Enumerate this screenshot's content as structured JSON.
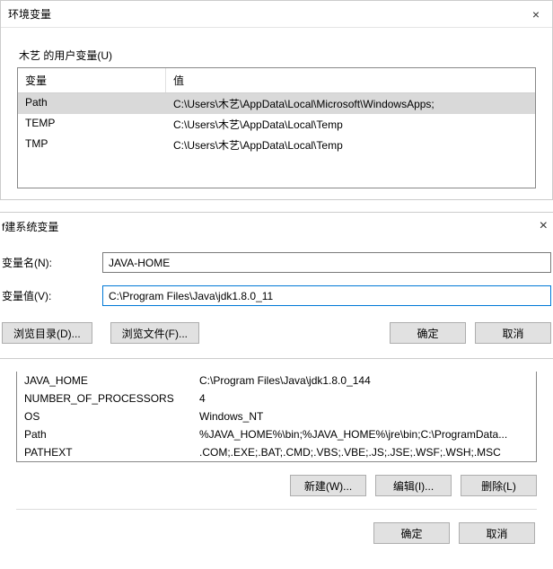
{
  "main_dialog": {
    "title": "环境变量",
    "user_section_label": "木艺 的用户变量(U)",
    "columns": {
      "var": "变量",
      "val": "值"
    },
    "user_vars": [
      {
        "name": "Path",
        "value": "C:\\Users\\木艺\\AppData\\Local\\Microsoft\\WindowsApps;"
      },
      {
        "name": "TEMP",
        "value": "C:\\Users\\木艺\\AppData\\Local\\Temp"
      },
      {
        "name": "TMP",
        "value": "C:\\Users\\木艺\\AppData\\Local\\Temp"
      }
    ]
  },
  "new_var_dialog": {
    "title": "f建系统变量",
    "name_label": "变量名(N):",
    "value_label": "变量值(V):",
    "name_value": "JAVA-HOME",
    "value_value": "C:\\Program Files\\Java\\jdk1.8.0_11",
    "buttons": {
      "browse_dir": "浏览目录(D)...",
      "browse_file": "浏览文件(F)...",
      "ok": "确定",
      "cancel": "取消"
    }
  },
  "system_vars": [
    {
      "name": "JAVA_HOME",
      "value": "C:\\Program Files\\Java\\jdk1.8.0_144"
    },
    {
      "name": "NUMBER_OF_PROCESSORS",
      "value": "4"
    },
    {
      "name": "OS",
      "value": "Windows_NT"
    },
    {
      "name": "Path",
      "value": "%JAVA_HOME%\\bin;%JAVA_HOME%\\jre\\bin;C:\\ProgramData..."
    },
    {
      "name": "PATHEXT",
      "value": ".COM;.EXE;.BAT;.CMD;.VBS;.VBE;.JS;.JSE;.WSF;.WSH;.MSC"
    }
  ],
  "sys_buttons": {
    "new": "新建(W)...",
    "edit": "编辑(I)...",
    "delete": "删除(L)"
  },
  "final_buttons": {
    "ok": "确定",
    "cancel": "取消"
  }
}
